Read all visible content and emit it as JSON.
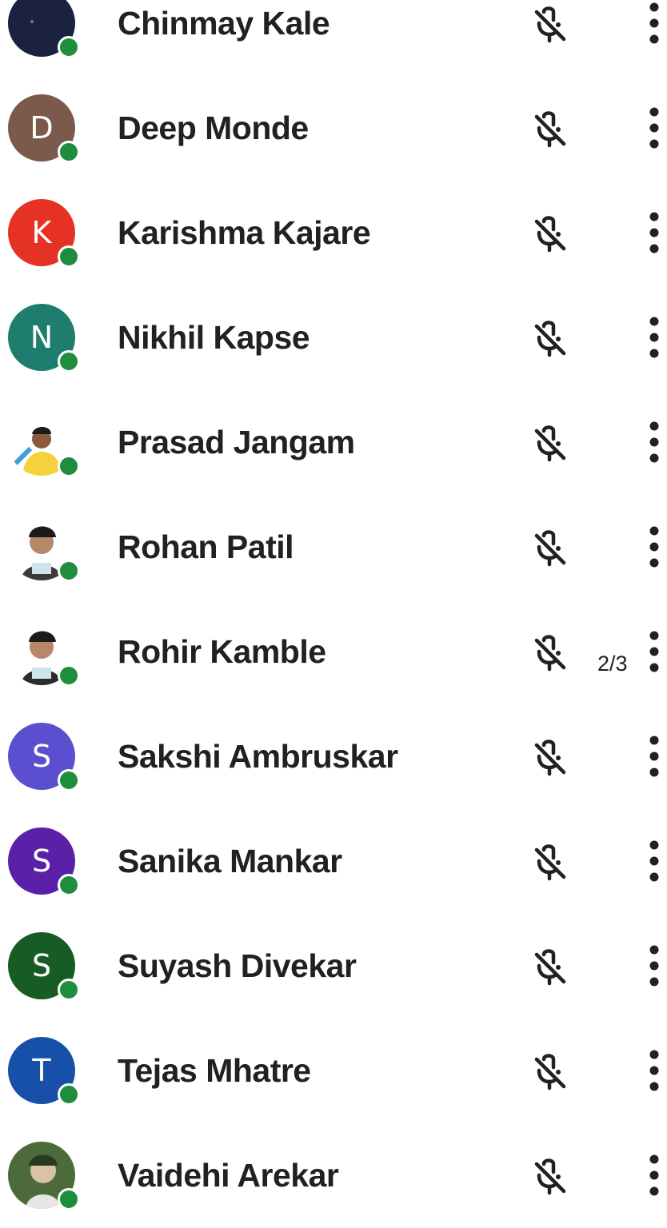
{
  "participants": [
    {
      "name": "Chinmay Kale",
      "initial": "",
      "avatar_color": "#1a2240",
      "avatar_type": "photo",
      "photo": "dark"
    },
    {
      "name": "Deep Monde",
      "initial": "D",
      "avatar_color": "#7b5a4c",
      "avatar_type": "initial"
    },
    {
      "name": "Karishma Kajare",
      "initial": "K",
      "avatar_color": "#e53225",
      "avatar_type": "initial"
    },
    {
      "name": "Nikhil Kapse",
      "initial": "N",
      "avatar_color": "#1f7d6f",
      "avatar_type": "initial"
    },
    {
      "name": "Prasad Jangam",
      "initial": "",
      "avatar_color": "#f4d33a",
      "avatar_type": "photo",
      "photo": "yellow"
    },
    {
      "name": "Rohan Patil",
      "initial": "",
      "avatar_color": "#3a3a3a",
      "avatar_type": "photo",
      "photo": "portrait"
    },
    {
      "name": "Rohir Kamble",
      "initial": "",
      "avatar_color": "#2b2b2b",
      "avatar_type": "photo",
      "photo": "portrait2"
    },
    {
      "name": "Sakshi Ambruskar",
      "initial": "S",
      "avatar_color": "#5b4fd0",
      "avatar_type": "initial"
    },
    {
      "name": "Sanika Mankar",
      "initial": "S",
      "avatar_color": "#5a20a8",
      "avatar_type": "initial"
    },
    {
      "name": "Suyash Divekar",
      "initial": "S",
      "avatar_color": "#175c25",
      "avatar_type": "initial"
    },
    {
      "name": "Tejas Mhatre",
      "initial": "T",
      "avatar_color": "#1750a8",
      "avatar_type": "initial"
    },
    {
      "name": "Vaidehi Arekar",
      "initial": "",
      "avatar_color": "#4d6b3a",
      "avatar_type": "photo",
      "photo": "green"
    }
  ],
  "icons": {
    "mic": "mic-off-icon",
    "menu": "more-vert-icon",
    "status": "online-status-dot"
  },
  "colors": {
    "online": "#1e8e3e",
    "text": "#202124",
    "indicator": "#c0392b"
  },
  "page_indicator": "2/3"
}
